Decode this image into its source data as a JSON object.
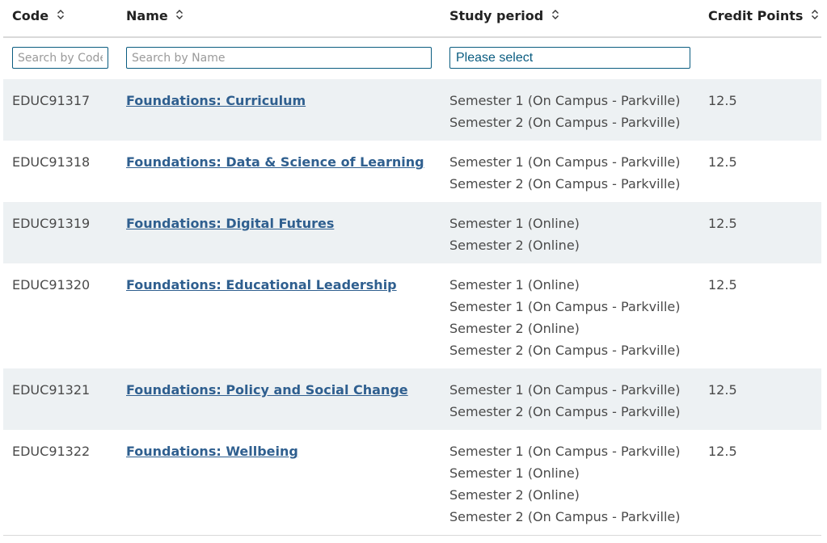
{
  "columns": {
    "code": "Code",
    "name": "Name",
    "study_period": "Study period",
    "credit_points": "Credit Points"
  },
  "filters": {
    "code_placeholder": "Search by Code",
    "name_placeholder": "Search by Name",
    "study_period_selected": "Please select"
  },
  "rows": [
    {
      "code": "EDUC91317",
      "name": "Foundations: Curriculum",
      "periods": [
        "Semester 1 (On Campus - Parkville)",
        "Semester 2 (On Campus - Parkville)"
      ],
      "credit": "12.5"
    },
    {
      "code": "EDUC91318",
      "name": "Foundations: Data & Science of Learning",
      "periods": [
        "Semester 1 (On Campus - Parkville)",
        "Semester 2 (On Campus - Parkville)"
      ],
      "credit": "12.5"
    },
    {
      "code": "EDUC91319",
      "name": "Foundations: Digital Futures",
      "periods": [
        "Semester 1 (Online)",
        "Semester 2 (Online)"
      ],
      "credit": "12.5"
    },
    {
      "code": "EDUC91320",
      "name": "Foundations: Educational Leadership",
      "periods": [
        "Semester 1 (Online)",
        "Semester 1 (On Campus - Parkville)",
        "Semester 2 (Online)",
        "Semester 2 (On Campus - Parkville)"
      ],
      "credit": "12.5"
    },
    {
      "code": "EDUC91321",
      "name": "Foundations: Policy and Social Change",
      "periods": [
        "Semester 1 (On Campus - Parkville)",
        "Semester 2 (On Campus - Parkville)"
      ],
      "credit": "12.5"
    },
    {
      "code": "EDUC91322",
      "name": "Foundations: Wellbeing",
      "periods": [
        "Semester 1 (On Campus - Parkville)",
        "Semester 1 (Online)",
        "Semester 2 (Online)",
        "Semester 2 (On Campus - Parkville)"
      ],
      "credit": "12.5"
    }
  ],
  "icons": {
    "sort": "sort-icon"
  },
  "colors": {
    "link": "#2f5f8f",
    "row_shade": "#edf1f3",
    "input_border": "#0a5c80"
  }
}
